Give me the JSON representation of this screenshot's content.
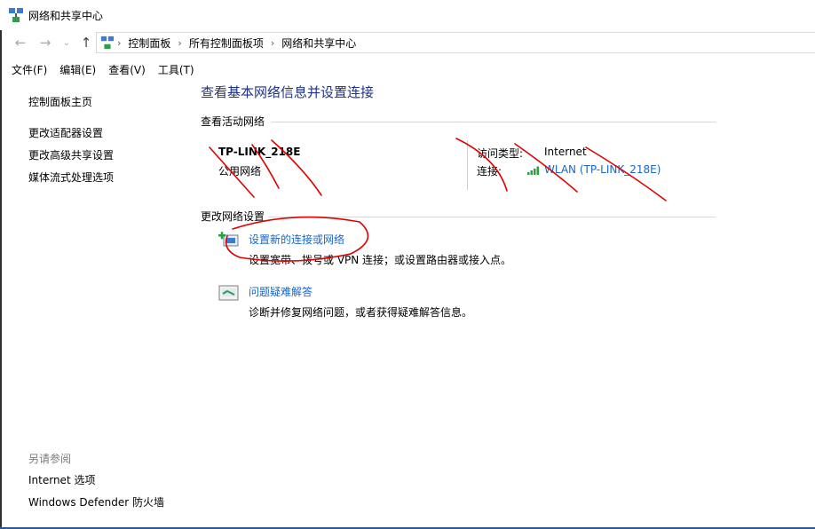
{
  "window": {
    "title": "网络和共享中心"
  },
  "address": {
    "breadcrumbs": [
      "控制面板",
      "所有控制面板项",
      "网络和共享中心"
    ]
  },
  "menu": [
    "文件(F)",
    "编辑(E)",
    "查看(V)",
    "工具(T)"
  ],
  "sidebar": {
    "items": [
      "控制面板主页",
      "更改适配器设置",
      "更改高级共享设置",
      "媒体流式处理选项"
    ],
    "see_also_label": "另请参阅",
    "see_also": [
      "Internet 选项",
      "Windows Defender 防火墙"
    ]
  },
  "main": {
    "title": "查看基本网络信息并设置连接",
    "active_networks_title": "查看活动网络",
    "network": {
      "name": "TP-LINK_218E",
      "category": "公用网络",
      "access_type_label": "访问类型:",
      "access_type_value": "Internet",
      "connection_label": "连接:",
      "connection_value": "WLAN (TP-LINK_218E)"
    },
    "change_settings_title": "更改网络设置",
    "tasks": [
      {
        "label": "设置新的连接或网络",
        "desc": "设置宽带、拨号或 VPN 连接；或设置路由器或接入点。"
      },
      {
        "label": "问题疑难解答",
        "desc": "诊断并修复网络问题，或者获得疑难解答信息。"
      }
    ]
  },
  "colors": {
    "link": "#1a66c9",
    "title": "#1e3287",
    "annotation": "#e00000"
  }
}
